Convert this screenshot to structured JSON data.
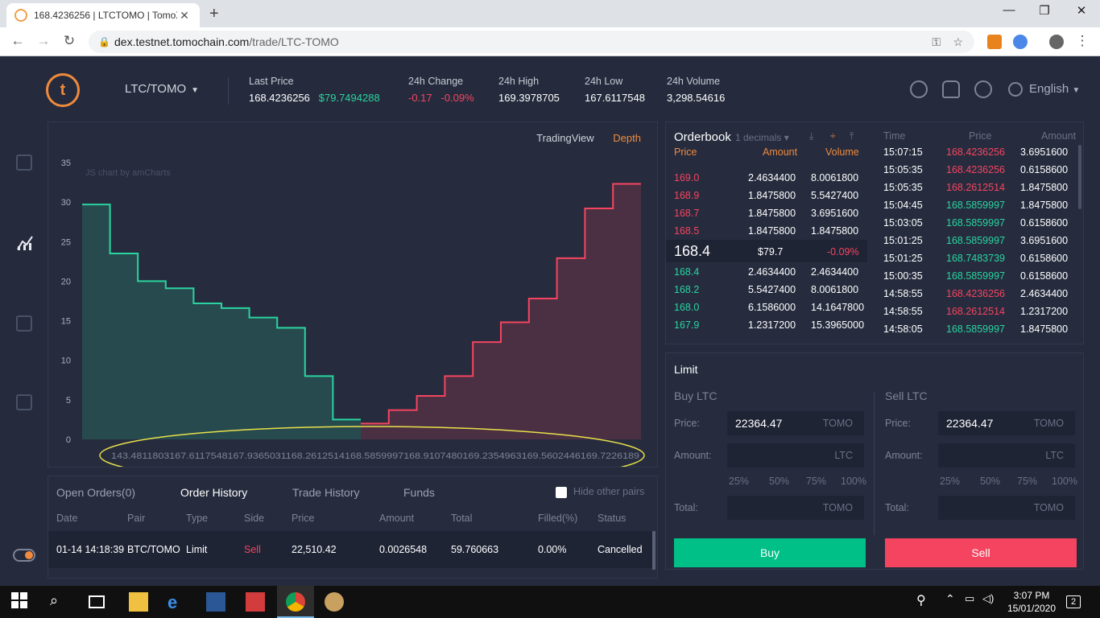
{
  "browser": {
    "tab_title": "168.4236256 | LTCTOMO | TomoX",
    "url_host": "dex.testnet.tomochain.com",
    "url_path": "/trade/LTC-TOMO"
  },
  "header": {
    "pair": "LTC/TOMO",
    "last_price_label": "Last Price",
    "last_price": "168.4236256",
    "last_price_usd": "$79.7494288",
    "change_label": "24h Change",
    "change_abs": "-0.17",
    "change_pct": "-0.09%",
    "high_label": "24h High",
    "high": "169.3978705",
    "low_label": "24h Low",
    "low": "167.6117548",
    "volume_label": "24h Volume",
    "volume": "3,298.54616",
    "language": "English"
  },
  "chart": {
    "tab_tradingview": "TradingView",
    "tab_depth": "Depth",
    "credit": "JS chart by amCharts",
    "y_ticks": [
      "35",
      "30",
      "25",
      "20",
      "15",
      "10",
      "5",
      "0"
    ],
    "x_axis_text": "143.4811803167.6117548167.9365031168.2612514168.5859997168.9107480169.2354963169.5602446169.7226189",
    "colors": {
      "bid": "#2ad4a0",
      "ask": "#f5445f",
      "accent": "#f08a3c"
    }
  },
  "chart_data": {
    "type": "area",
    "ylim": [
      0,
      35
    ],
    "x_ticks": [
      "143.4811803",
      "167.6117548",
      "167.9365031",
      "168.2612514",
      "168.5859997",
      "168.9107480",
      "169.2354963",
      "169.5602446",
      "169.7226189"
    ],
    "series": [
      {
        "values": [
          29.7,
          23.5,
          20.0,
          19.1,
          17.2,
          16.6,
          15.4,
          14.1,
          8.0,
          2.5
        ]
      },
      {
        "values": [
          2.0,
          3.7,
          5.5,
          8.0,
          12.3,
          14.8,
          17.8,
          22.9,
          29.2,
          32.3
        ]
      }
    ]
  },
  "orderbook": {
    "title": "Orderbook",
    "decimals": "1 decimals",
    "col_price": "Price",
    "col_amount": "Amount",
    "col_volume": "Volume",
    "asks": [
      {
        "price": "169.0",
        "amount": "2.4634400",
        "volume": "8.0061800"
      },
      {
        "price": "168.9",
        "amount": "1.8475800",
        "volume": "5.5427400"
      },
      {
        "price": "168.7",
        "amount": "1.8475800",
        "volume": "3.6951600"
      },
      {
        "price": "168.5",
        "amount": "1.8475800",
        "volume": "1.8475800"
      }
    ],
    "mid_price": "168.4",
    "mid_usd": "$79.7",
    "mid_change": "-0.09%",
    "bids": [
      {
        "price": "168.4",
        "amount": "2.4634400",
        "volume": "2.4634400"
      },
      {
        "price": "168.2",
        "amount": "5.5427400",
        "volume": "8.0061800"
      },
      {
        "price": "168.0",
        "amount": "6.1586000",
        "volume": "14.1647800"
      },
      {
        "price": "167.9",
        "amount": "1.2317200",
        "volume": "15.3965000"
      }
    ]
  },
  "trades": {
    "col_time": "Time",
    "col_price": "Price",
    "col_amount": "Amount",
    "rows": [
      {
        "time": "15:07:15",
        "price": "168.4236256",
        "amount": "3.6951600",
        "side": "sell"
      },
      {
        "time": "15:05:35",
        "price": "168.4236256",
        "amount": "0.6158600",
        "side": "sell"
      },
      {
        "time": "15:05:35",
        "price": "168.2612514",
        "amount": "1.8475800",
        "side": "sell"
      },
      {
        "time": "15:04:45",
        "price": "168.5859997",
        "amount": "1.8475800",
        "side": "buy"
      },
      {
        "time": "15:03:05",
        "price": "168.5859997",
        "amount": "0.6158600",
        "side": "buy"
      },
      {
        "time": "15:01:25",
        "price": "168.5859997",
        "amount": "3.6951600",
        "side": "buy"
      },
      {
        "time": "15:01:25",
        "price": "168.7483739",
        "amount": "0.6158600",
        "side": "buy"
      },
      {
        "time": "15:00:35",
        "price": "168.5859997",
        "amount": "0.6158600",
        "side": "buy"
      },
      {
        "time": "14:58:55",
        "price": "168.4236256",
        "amount": "2.4634400",
        "side": "sell"
      },
      {
        "time": "14:58:55",
        "price": "168.2612514",
        "amount": "1.2317200",
        "side": "sell"
      },
      {
        "time": "14:58:05",
        "price": "168.5859997",
        "amount": "1.8475800",
        "side": "buy"
      }
    ]
  },
  "limit": {
    "title": "Limit",
    "buy_title": "Buy LTC",
    "sell_title": "Sell LTC",
    "price_label": "Price:",
    "amount_label": "Amount:",
    "total_label": "Total:",
    "buy_price": "22364.47",
    "sell_price": "22364.47",
    "quote_unit": "TOMO",
    "base_unit": "LTC",
    "pcts": [
      "25%",
      "50%",
      "75%",
      "100%"
    ],
    "buy_button": "Buy",
    "sell_button": "Sell"
  },
  "orders": {
    "tabs": [
      "Open Orders(0)",
      "Order History",
      "Trade History",
      "Funds"
    ],
    "hide_other": "Hide other pairs",
    "headers": [
      "Date",
      "Pair",
      "Type",
      "Side",
      "Price",
      "Amount",
      "Total",
      "Filled(%)",
      "Status"
    ],
    "row": {
      "date": "01-14 14:18:39",
      "pair": "BTC/TOMO",
      "type": "Limit",
      "side": "Sell",
      "price": "22,510.42",
      "amount": "0.0026548",
      "total": "59.760663",
      "filled": "0.00%",
      "status": "Cancelled"
    }
  },
  "taskbar": {
    "time": "3:07 PM",
    "date": "15/01/2020",
    "notifications": "2"
  }
}
